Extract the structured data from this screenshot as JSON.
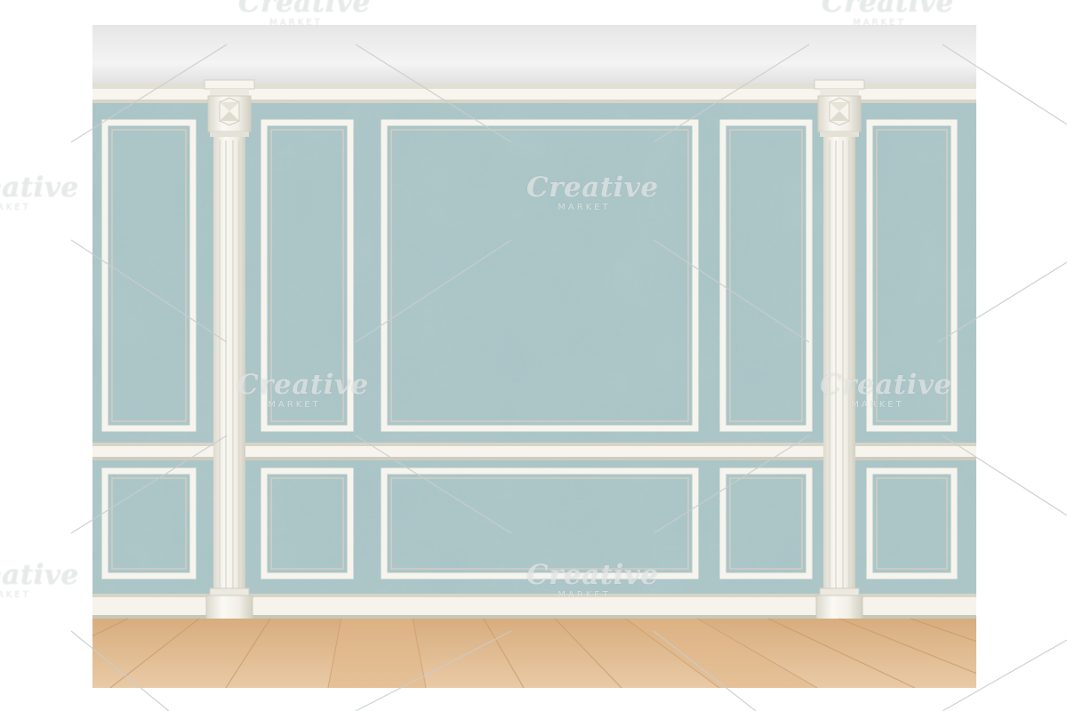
{
  "scene": {
    "colors": {
      "wall": "#a9c4c6",
      "molding": "#f4f2ea",
      "molding_shadow": "#d6d3c6",
      "ceiling": "#eeeeee",
      "floor_light": "#e7c7a2",
      "floor_dark": "#d6a978"
    }
  },
  "watermark": {
    "brand": "Creative",
    "sub": "MARKET"
  }
}
